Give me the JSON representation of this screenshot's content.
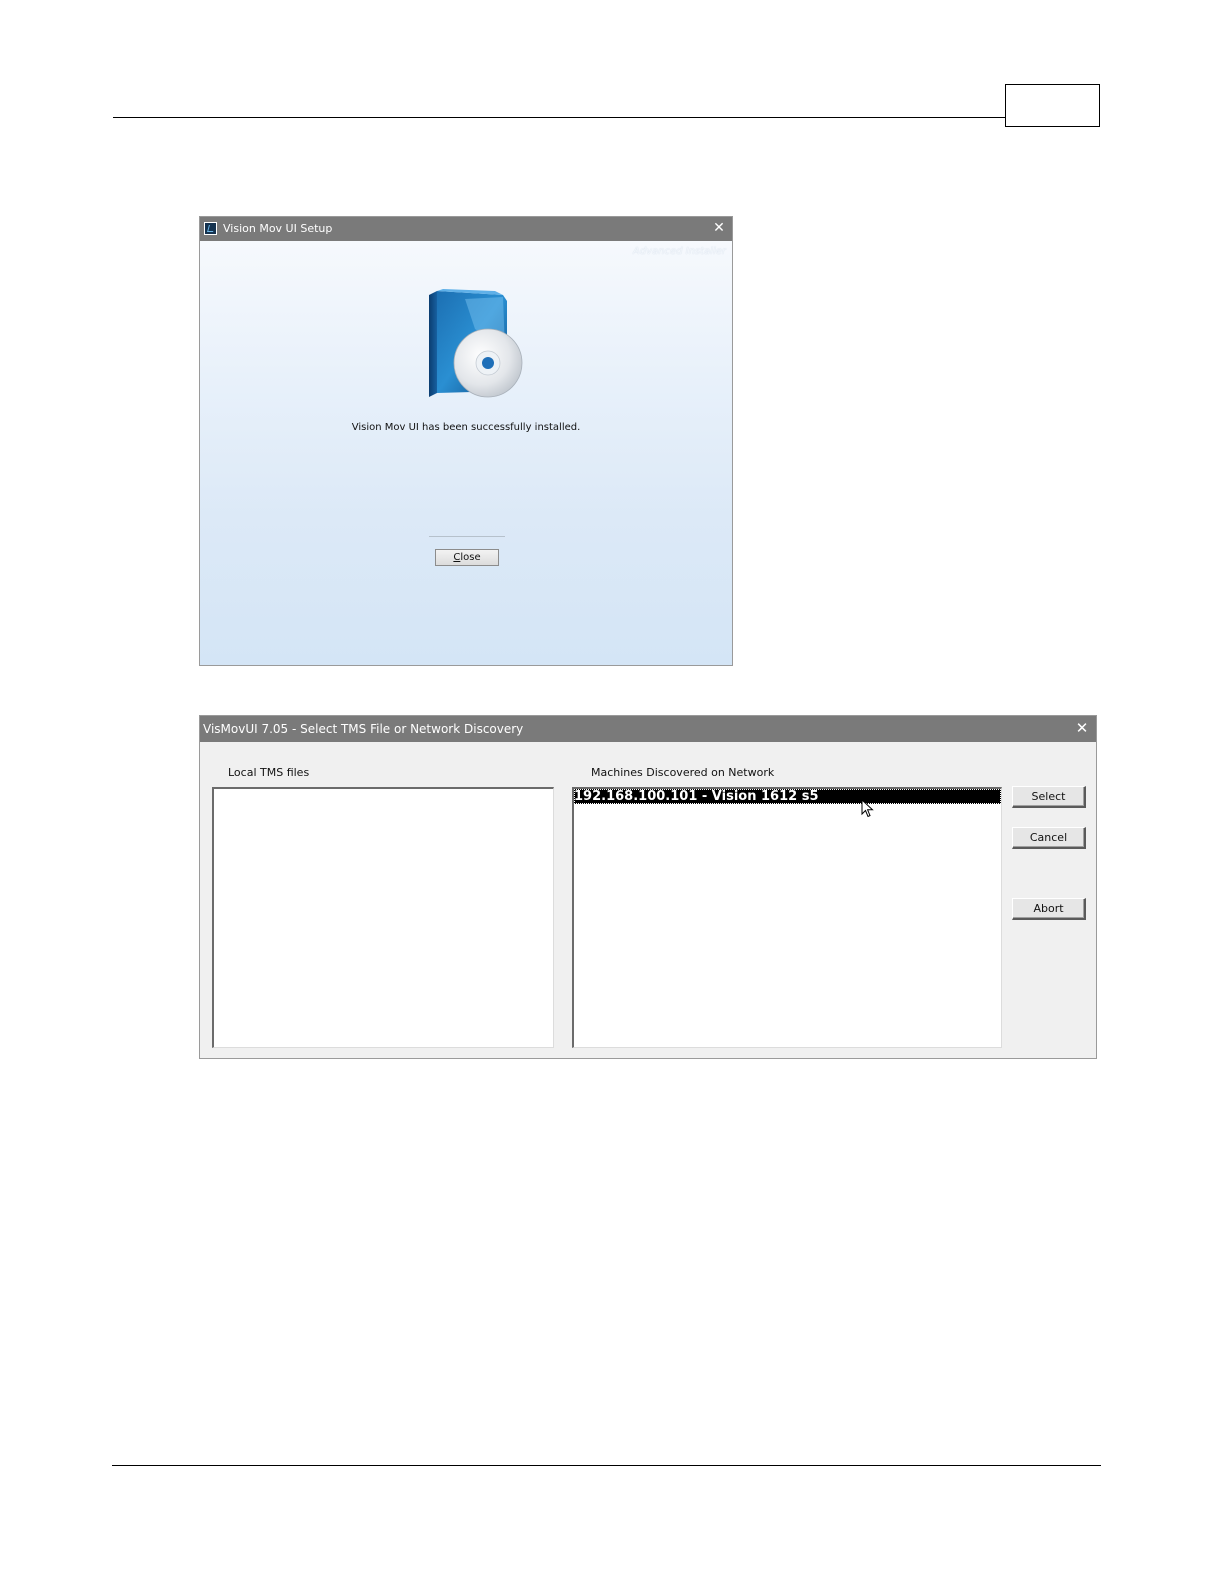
{
  "setup_window": {
    "title": "Vision Mov UI Setup",
    "close_glyph": "✕",
    "watermark": "Advanced Installer",
    "message": "Vision Mov UI has been successfully installed.",
    "close_button": {
      "mnemonic": "C",
      "rest": "lose"
    },
    "icons": [
      "app-icon",
      "close-icon",
      "product-box-cd-icon"
    ]
  },
  "discovery_dialog": {
    "title": "VisMovUI 7.05 - Select TMS File or Network Discovery",
    "close_glyph": "✕",
    "local_label": "Local TMS files",
    "local_files": [],
    "network_label": "Machines Discovered on Network",
    "machines": [
      "192.168.100.101 - Vision 1612 s5"
    ],
    "buttons": {
      "select": "Select",
      "cancel": "Cancel",
      "abort": "Abort"
    },
    "icons": [
      "close-icon",
      "mouse-pointer-icon"
    ]
  },
  "colors": {
    "titlebar": "#7a7a7a",
    "dialog_bg": "#f0f0f0",
    "selection": "#000000"
  }
}
